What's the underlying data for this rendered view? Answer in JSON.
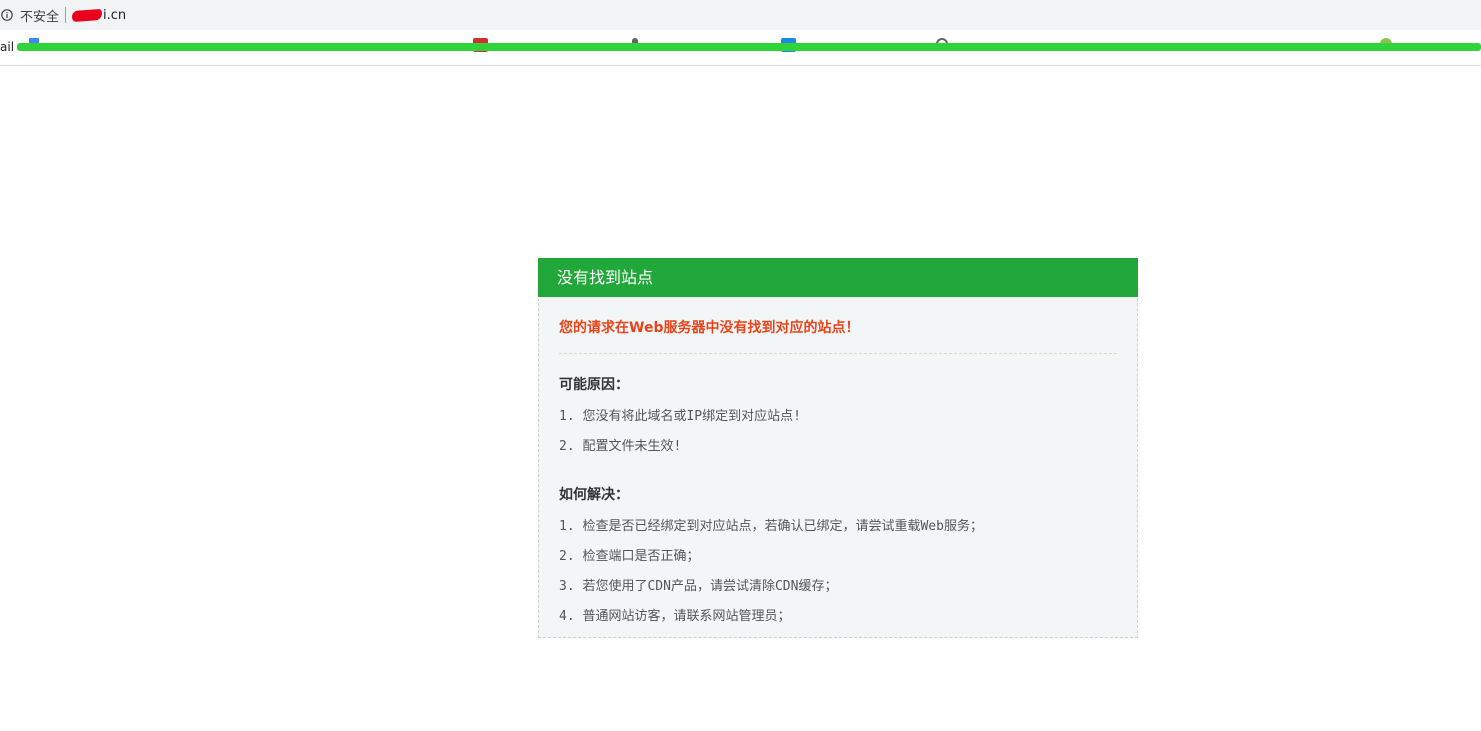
{
  "browser": {
    "security_label": "不安全",
    "url_suffix": "i.cn",
    "bookmarks_left_label": "ail",
    "icons": [
      "info-icon",
      "bookmark-icon",
      "pdf-icon",
      "pin-icon",
      "browser-icon",
      "globe-icon",
      "user-icon"
    ],
    "redaction_color": "#2fd33a"
  },
  "panel": {
    "header": "没有找到站点",
    "message": "您的请求在Web服务器中没有找到对应的站点！",
    "causes_title": "可能原因：",
    "causes": [
      "1. 您没有将此域名或IP绑定到对应站点!",
      "2. 配置文件未生效!"
    ],
    "solutions_title": "如何解决：",
    "solutions": [
      "1. 检查是否已经绑定到对应站点，若确认已绑定，请尝试重载Web服务；",
      "2. 检查端口是否正确；",
      "3. 若您使用了CDN产品，请尝试清除CDN缓存；",
      "4. 普通网站访客，请联系网站管理员；"
    ]
  },
  "colors": {
    "header_bg": "#22a73a",
    "message_text": "#e8441a",
    "panel_bg": "#f3f6f7"
  }
}
